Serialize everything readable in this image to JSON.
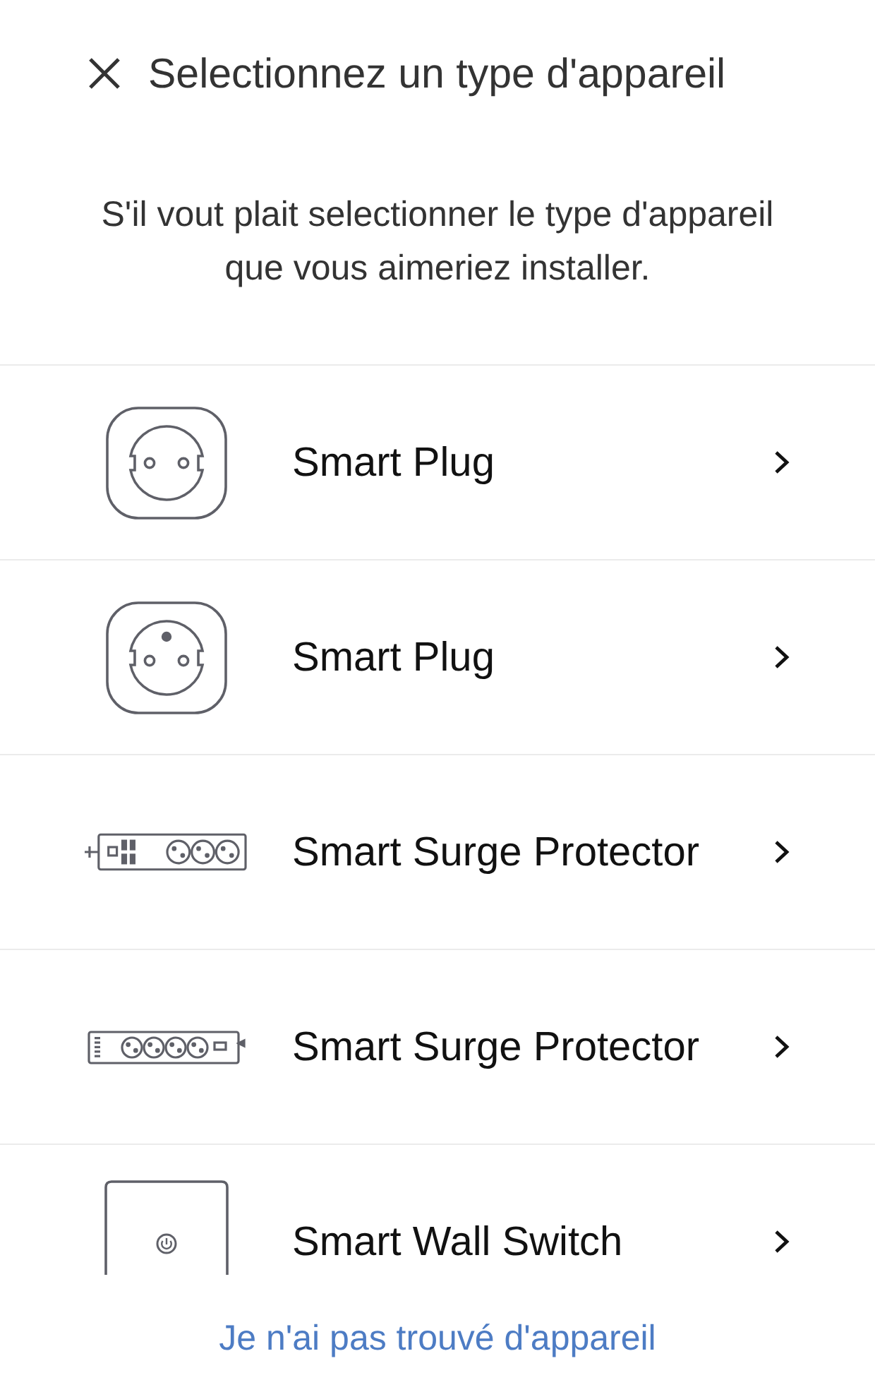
{
  "header": {
    "title": "Selectionnez un type d'appareil"
  },
  "instructions": "S'il vout plait selectionner le type d'appareil que vous aimeriez installer.",
  "device_types": [
    {
      "kind": "plug-two-pin",
      "label": "Smart Plug"
    },
    {
      "kind": "plug-earth-pin",
      "label": "Smart Plug"
    },
    {
      "kind": "strip-three",
      "label": "Smart Surge Protector"
    },
    {
      "kind": "strip-four",
      "label": "Smart Surge Protector"
    },
    {
      "kind": "wall-switch",
      "label": "Smart Wall Switch"
    }
  ],
  "footer_link": "Je n'ai pas trouvé d'appareil"
}
